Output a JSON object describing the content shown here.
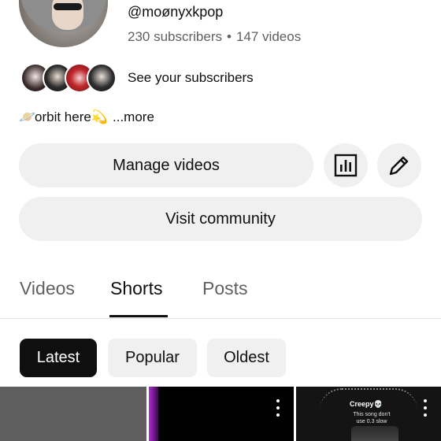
{
  "channel": {
    "handle": "@moønyxkpop",
    "subscribers": "230 subscribers",
    "separator": "•",
    "videos": "147 videos"
  },
  "subscribers_link": "See your subscribers",
  "bio": {
    "planet": "🪐",
    "text": "orbit here",
    "sparkle": "💫",
    "more": "...more"
  },
  "buttons": {
    "manage": "Manage videos",
    "community": "Visit community",
    "analytics_icon": "analytics-icon",
    "edit_icon": "pencil-icon"
  },
  "tabs": [
    {
      "label": "Videos",
      "active": false
    },
    {
      "label": "Shorts",
      "active": true
    },
    {
      "label": "Posts",
      "active": false
    }
  ],
  "filters": [
    {
      "label": "Latest",
      "selected": true
    },
    {
      "label": "Popular",
      "selected": false
    },
    {
      "label": "Oldest",
      "selected": false
    }
  ],
  "shorts": [
    {
      "thumbnail": "grey"
    },
    {
      "thumbnail": "purple-dark"
    },
    {
      "title": "Creepy💀",
      "subtitle": "This song don't use 0.3 slow"
    }
  ],
  "colors": {
    "chip_selected": "#0f0f0f",
    "chip_default": "#f0f0f0",
    "secondary_text": "#606060"
  }
}
